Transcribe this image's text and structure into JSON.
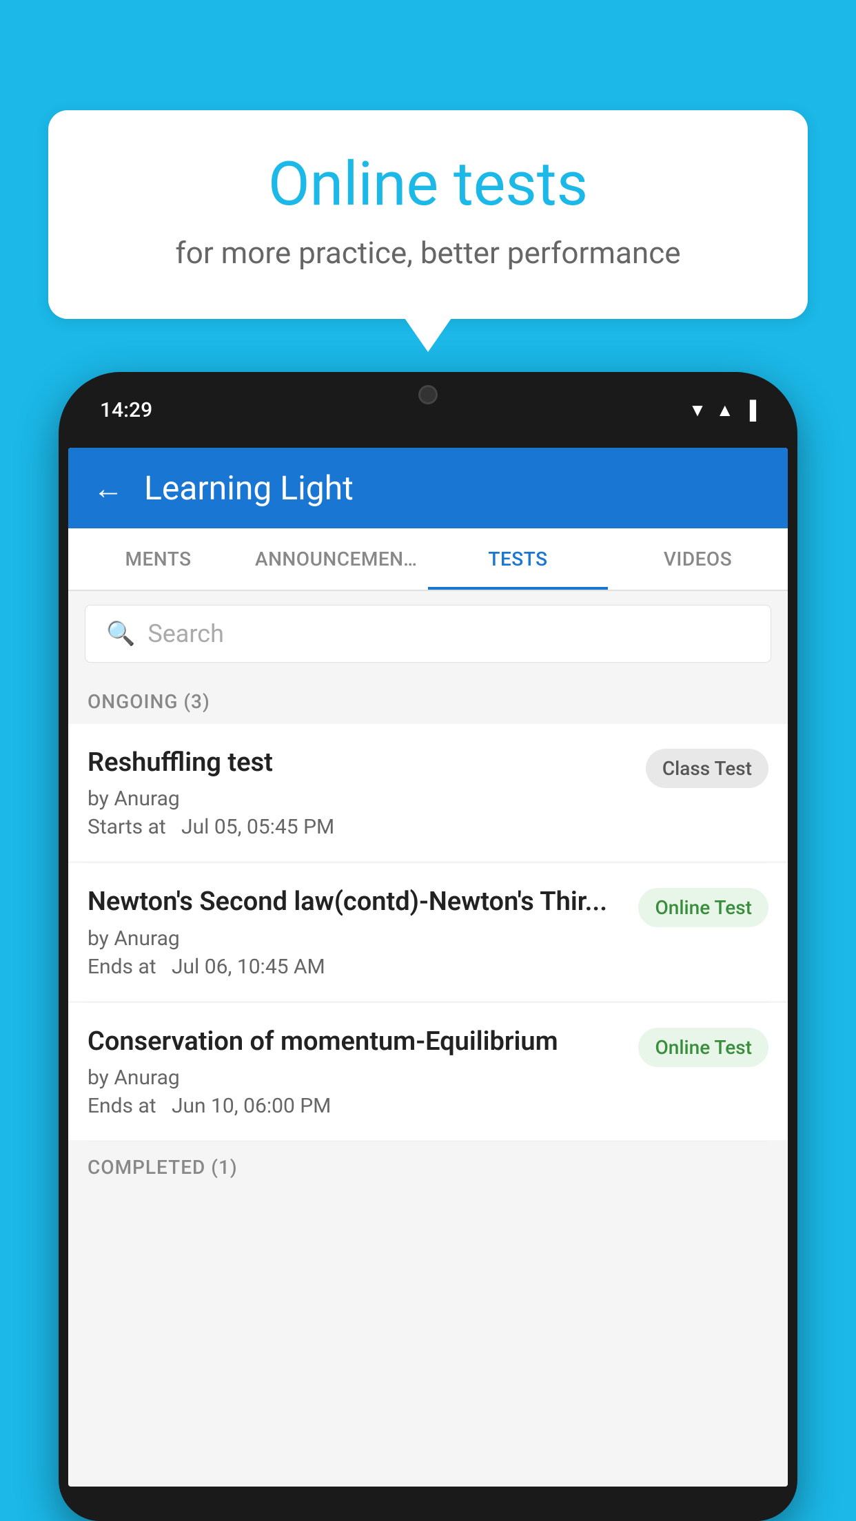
{
  "background_color": "#1BB8E8",
  "speech_bubble": {
    "title": "Online tests",
    "subtitle": "for more practice, better performance"
  },
  "phone": {
    "status_bar": {
      "time": "14:29",
      "wifi_icon": "▼",
      "signal_icon": "▲",
      "battery_icon": "▐"
    },
    "app_header": {
      "title": "Learning Light",
      "back_label": "←"
    },
    "tabs": [
      {
        "label": "MENTS",
        "active": false
      },
      {
        "label": "ANNOUNCEMENTS",
        "active": false
      },
      {
        "label": "TESTS",
        "active": true
      },
      {
        "label": "VIDEOS",
        "active": false
      }
    ],
    "search": {
      "placeholder": "Search"
    },
    "ongoing_section": {
      "label": "ONGOING (3)"
    },
    "tests": [
      {
        "name": "Reshuffling test",
        "author": "by Anurag",
        "time_label": "Starts at",
        "time_value": "Jul 05, 05:45 PM",
        "badge": "Class Test",
        "badge_type": "class"
      },
      {
        "name": "Newton's Second law(contd)-Newton's Thir...",
        "author": "by Anurag",
        "time_label": "Ends at",
        "time_value": "Jul 06, 10:45 AM",
        "badge": "Online Test",
        "badge_type": "online"
      },
      {
        "name": "Conservation of momentum-Equilibrium",
        "author": "by Anurag",
        "time_label": "Ends at",
        "time_value": "Jun 10, 06:00 PM",
        "badge": "Online Test",
        "badge_type": "online"
      }
    ],
    "completed_section": {
      "label": "COMPLETED (1)"
    }
  }
}
